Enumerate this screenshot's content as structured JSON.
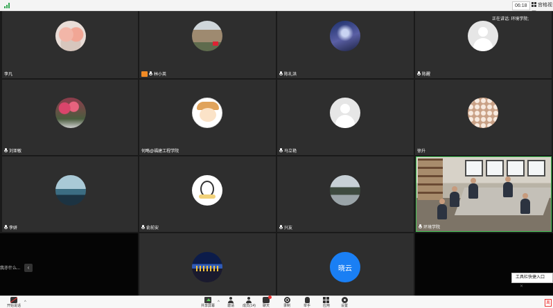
{
  "topbar": {
    "timer": "06:18",
    "gallery_view_label": "宫格视图",
    "speaking_label": "正在讲话: 环境学院;"
  },
  "tiles": [
    {
      "name": "李凡",
      "avatar": "pig-icon",
      "host": false
    },
    {
      "name": "林小英",
      "avatar": "pagoda-photo",
      "host": true
    },
    {
      "name": "陈礼洪",
      "avatar": "galaxy-photo",
      "host": false
    },
    {
      "name": "陈醒",
      "avatar": "default-user-icon",
      "host": false
    },
    {
      "name": "刘亚敏",
      "avatar": "flowers-photo",
      "host": false
    },
    {
      "name": "何略@福建工程学院",
      "avatar": "cartoon-avatar",
      "host": false
    },
    {
      "name": "马立艳",
      "avatar": "default-user-icon",
      "host": false
    },
    {
      "name": "徐升",
      "avatar": "cherry-blossom-photo",
      "host": false
    },
    {
      "name": "李妍",
      "avatar": "lake-photo",
      "host": false
    },
    {
      "name": "俞前安",
      "avatar": "bunny-sticker",
      "host": false
    },
    {
      "name": "兴友",
      "avatar": "tree-photo",
      "host": false
    },
    {
      "name": "环境学院",
      "avatar": "video-feed",
      "host": false
    },
    {
      "name": "",
      "avatar": "city-night-photo",
      "host": false
    },
    {
      "name": "",
      "avatar_text": "晓云",
      "host": false
    }
  ],
  "side_chat": {
    "text": "我亦什么..."
  },
  "tool_entry": {
    "label": "工具栏快捷入口"
  },
  "toolbar": {
    "mute_label": "开始说话",
    "share_label": "共享屏幕",
    "invite_label": "邀请",
    "members_label": "成员(14)",
    "chat_label": "聊天",
    "record_label": "录制",
    "raise_hand_label": "举手",
    "apps_label": "应用",
    "settings_label": "设置",
    "end_label": "离"
  }
}
